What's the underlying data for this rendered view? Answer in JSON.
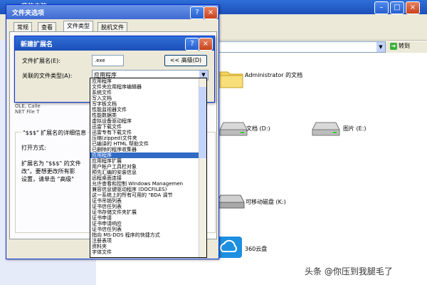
{
  "explorer": {
    "title": "我的电脑",
    "go_button": "转到",
    "items": [
      {
        "label": "Administrator 的文档"
      },
      {
        "label": "文档 (D:)"
      },
      {
        "label": "图片 (E:)"
      },
      {
        "label": "可移动磁盘 (K:)"
      },
      {
        "label": "360云盘"
      }
    ]
  },
  "folder_options": {
    "title": "文件夹选项",
    "tabs": [
      "常规",
      "查看",
      "文件类型",
      "脱机文件"
    ],
    "list_row_1": "OLE, Calle",
    "list_row_2": "NET File T",
    "details_heading": "\"$$$\" 扩展名的详细信息",
    "open_with_label": "打开方式:",
    "desc_line1": "扩展名为 \"$$$\" 的文件",
    "desc_line2": "改\"。要想更改所有影",
    "desc_line3": "设置，请单击 \"高级\""
  },
  "new_extension": {
    "title": "新建扩展名",
    "ext_label": "文件扩展名(E):",
    "ext_value": ".exe",
    "advanced_button": "<< 高级(D)",
    "assoc_label": "关联的文件类型(A):",
    "assoc_selected": "应用程序",
    "dropdown_items": [
      "应用程序",
      "文件夹应用程序编辑器",
      "系统文件",
      "写入文档",
      "写字板文档",
      "性能监视器文件",
      "性能数据类",
      "虚拟设备驱动程序",
      "迅雷下载文件",
      "迅雷专有下载文件",
      "压缩(zipped)文件夹",
      "已编译的 HTML 帮助文件",
      "已删除的程序收集器",
      "应用程序",
      "应用程序扩展",
      "用户帐户工具栏对象",
      "预先汇编的安装信息",
      "远程桌面连接",
      "允许查看和控制 Windows Managemen",
      "兼容信息键驱动程序 (DOCFILES)",
      "这一系统上的所有可用的 \"BDA 调节",
      "证书吊销列表",
      "证书信任列表",
      "证书存储文件夹扩展",
      "证书申请",
      "证书申请响应",
      "证书信任列表",
      "指向 MS-DOS 程序的快捷方式",
      "注册表项",
      "资料夹",
      "字体文件"
    ],
    "selected_index": 13
  },
  "watermark": "头条 @你压到我腿毛了"
}
